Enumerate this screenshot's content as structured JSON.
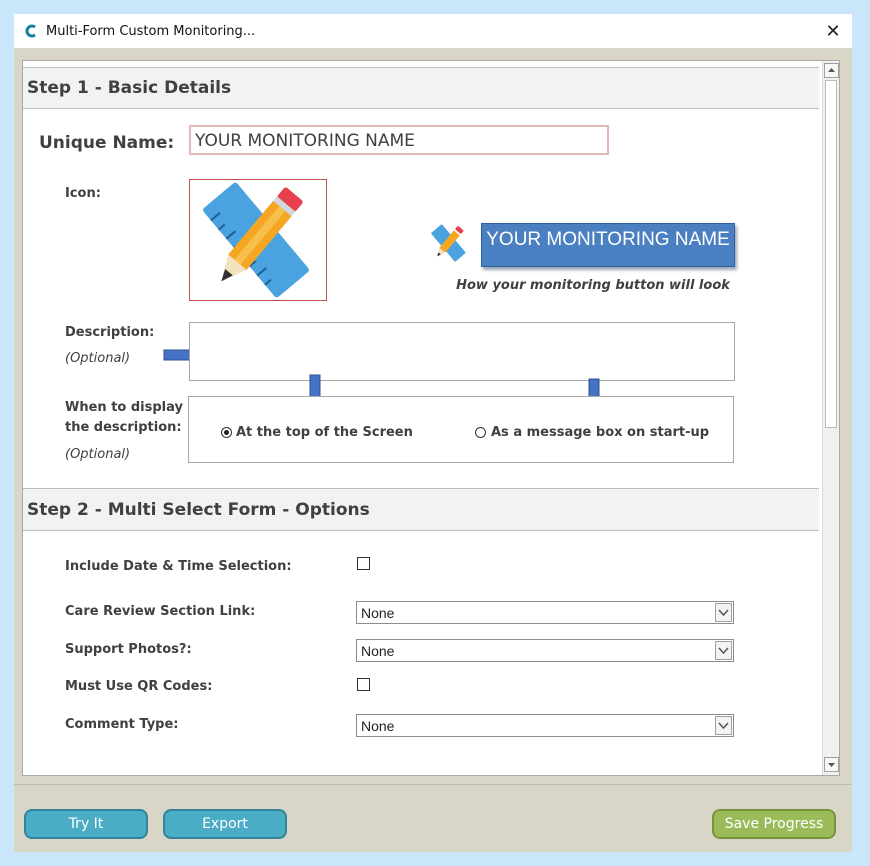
{
  "window": {
    "title": "Multi-Form Custom Monitoring...",
    "close_symbol": "✕"
  },
  "step1": {
    "header": "Step 1 - Basic Details",
    "unique_name_label": "Unique Name:",
    "unique_name_value": "YOUR MONITORING NAME",
    "icon_label": "Icon:",
    "preview_button_text": "YOUR MONITORING NAME",
    "preview_caption": "How your monitoring button will look",
    "description_label": "Description:",
    "description_optional": "(Optional)",
    "description_value": "",
    "display_label_line1": "When to display",
    "display_label_line2": "the description:",
    "display_optional": "(Optional)",
    "display_options": [
      {
        "label": "At the top of the Screen",
        "selected": true
      },
      {
        "label": "As a message box on start-up",
        "selected": false
      }
    ]
  },
  "step2": {
    "header": "Step 2 - Multi Select Form - Options",
    "date_time_label": "Include Date & Time Selection:",
    "date_time_checked": false,
    "care_review_label": "Care Review Section Link:",
    "care_review_value": "None",
    "support_photos_label": "Support Photos?:",
    "support_photos_value": "None",
    "qr_label": "Must Use QR Codes:",
    "qr_checked": false,
    "comment_type_label": "Comment Type:",
    "comment_type_value": "None"
  },
  "footer": {
    "try_it": "Try It",
    "export": "Export",
    "save_progress": "Save Progress"
  },
  "colors": {
    "accent_blue_button": "#4aacc5",
    "save_green": "#9bbb59",
    "preview_button": "#4a7fc1",
    "arrow_blue": "#4472c4"
  },
  "icons": [
    "app-logo-icon",
    "close-icon",
    "pencil-ruler-icon",
    "arrow-right-icon",
    "arrow-down-icon",
    "chevron-down-icon"
  ]
}
